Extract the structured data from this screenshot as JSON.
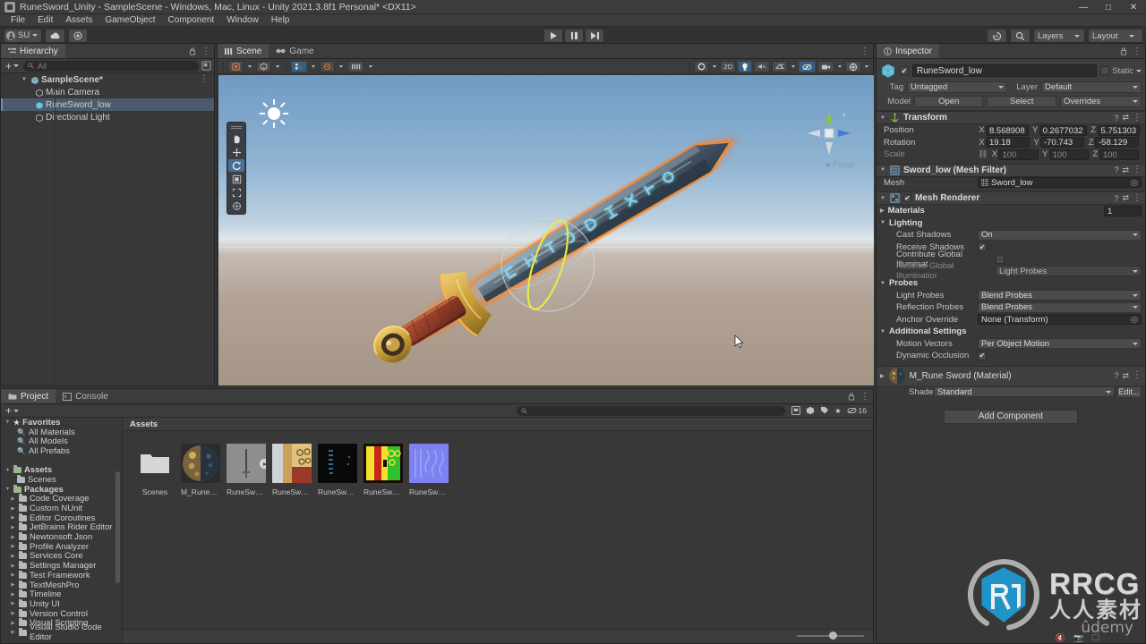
{
  "window": {
    "title": "RuneSword_Unity - SampleScene - Windows, Mac, Linux - Unity 2021.3.8f1 Personal* <DX11>",
    "app_icon": "unity-icon",
    "minimize": "—",
    "maximize": "□",
    "close": "✕"
  },
  "menu": {
    "items": [
      "File",
      "Edit",
      "Assets",
      "GameObject",
      "Component",
      "Window",
      "Help"
    ]
  },
  "toolbar": {
    "account_label": "SU",
    "cloud_icon": "cloud-icon",
    "services_icon": "unity-services-icon",
    "play_label": "play-icon",
    "pause_label": "pause-icon",
    "step_label": "step-icon",
    "history_icon": "undo-history-icon",
    "search_icon": "search-icon",
    "layers_label": "Layers",
    "layout_label": "Layout"
  },
  "hierarchy": {
    "tab_label": "Hierarchy",
    "tab_icon": "hierarchy-icon",
    "lock_icon": "lock-icon",
    "menu_icon": "kebab-icon",
    "add_label": "+",
    "search_placeholder": "All",
    "items": [
      {
        "label": "SampleScene*",
        "icon": "scene-icon",
        "depth": 0,
        "selected": false,
        "expanded": true
      },
      {
        "label": "Main Camera",
        "icon": "gameobject-icon",
        "depth": 1,
        "selected": false
      },
      {
        "label": "RuneSword_low",
        "icon": "prefab-model-icon",
        "depth": 1,
        "selected": true
      },
      {
        "label": "Directional Light",
        "icon": "gameobject-icon",
        "depth": 1,
        "selected": false
      }
    ]
  },
  "scene_panel": {
    "tabs": [
      {
        "label": "Scene",
        "icon": "scene-tab-icon",
        "active": true
      },
      {
        "label": "Game",
        "icon": "game-tab-icon",
        "active": false
      }
    ],
    "toolbar_left": [
      {
        "name": "draw-mode-shaded",
        "icon": "shaded-icon"
      },
      {
        "name": "shading-mode",
        "icon": "cube-wire-icon"
      },
      {
        "name": "2d-toggle-group",
        "icon": "grid-axis-icon",
        "active": true
      },
      {
        "name": "lighting-toggle",
        "icon": "audio-icon"
      },
      {
        "name": "grid-snap",
        "icon": "grid-snap-icon"
      }
    ],
    "toolbar_right": [
      {
        "name": "scene-view-lighting",
        "icon": "globe-icon"
      },
      {
        "name": "2d-button",
        "label": "2D"
      },
      {
        "name": "scene-lighting-toggle",
        "icon": "bulb-icon",
        "active": true
      },
      {
        "name": "audio-toggle",
        "icon": "speaker-mute-icon"
      },
      {
        "name": "fx-toggle",
        "icon": "fx-icon"
      },
      {
        "name": "hidden-toggle",
        "icon": "eye-off-icon",
        "active": true
      },
      {
        "name": "camera-settings",
        "icon": "camera-icon"
      },
      {
        "name": "gizmos-toggle",
        "icon": "gizmos-icon"
      }
    ],
    "tools_palette": [
      {
        "name": "hand-tool",
        "icon": "hand-icon",
        "active": false
      },
      {
        "name": "move-tool",
        "icon": "move-icon",
        "active": false
      },
      {
        "name": "rotate-tool",
        "icon": "rotate-icon",
        "active": true
      },
      {
        "name": "scale-tool",
        "icon": "scale-icon",
        "active": false
      },
      {
        "name": "rect-tool",
        "icon": "rect-icon",
        "active": false
      },
      {
        "name": "transform-tool",
        "icon": "transform-icon",
        "active": false
      }
    ],
    "gizmo_label": "Persp",
    "scene_object": "RuneSword_low sword 3D model",
    "sun_gizmo": "directional-light-gizmo"
  },
  "inspector": {
    "tab_label": "Inspector",
    "tab_icon": "inspector-icon",
    "lock_icon": "lock-icon",
    "menu_icon": "kebab-icon",
    "gameobject": {
      "enabled": true,
      "name": "RuneSword_low",
      "static_label": "Static",
      "tag_label": "Tag",
      "tag_value": "Untagged",
      "layer_label": "Layer",
      "layer_value": "Default",
      "model_label": "Model",
      "open_label": "Open",
      "select_label": "Select",
      "overrides_label": "Overrides"
    },
    "transform": {
      "title": "Transform",
      "icon": "transform-component-icon",
      "rows": [
        {
          "label": "Position",
          "x": "8.568908",
          "y": "0.2677032",
          "z": "5.751303",
          "dim": false
        },
        {
          "label": "Rotation",
          "x": "19.18",
          "y": "-70.743",
          "z": "-58.129",
          "dim": false
        },
        {
          "label": "Scale",
          "x": "100",
          "y": "100",
          "z": "100",
          "dim": true,
          "lock_icon": "link-icon"
        }
      ]
    },
    "mesh_filter": {
      "title": "Sword_low (Mesh Filter)",
      "icon": "mesh-filter-icon",
      "mesh_label": "Mesh",
      "mesh_value": "Sword_low"
    },
    "mesh_renderer": {
      "title": "Mesh Renderer",
      "icon": "mesh-renderer-icon",
      "enabled": true,
      "materials_label": "Materials",
      "materials_count": "1",
      "lighting_label": "Lighting",
      "cast_shadows_label": "Cast Shadows",
      "cast_shadows_value": "On",
      "receive_shadows_label": "Receive Shadows",
      "receive_shadows_checked": true,
      "contribute_gi_label": "Contribute Global Illuminat",
      "contribute_gi_checked": false,
      "receive_gi_label": "Receive Global Illuminatior",
      "receive_gi_value": "Light Probes",
      "probes_label": "Probes",
      "light_probes_label": "Light Probes",
      "light_probes_value": "Blend Probes",
      "reflection_probes_label": "Reflection Probes",
      "reflection_probes_value": "Blend Probes",
      "anchor_override_label": "Anchor Override",
      "anchor_override_value": "None (Transform)",
      "additional_settings_label": "Additional Settings",
      "motion_vectors_label": "Motion Vectors",
      "motion_vectors_value": "Per Object Motion",
      "dynamic_occlusion_label": "Dynamic Occlusion",
      "dynamic_occlusion_checked": true
    },
    "material": {
      "title": "M_Rune Sword (Material)",
      "shader_label": "Shader",
      "shader_value": "Standard",
      "edit_label": "Edit..."
    },
    "add_component_label": "Add Component"
  },
  "project": {
    "tabs": [
      {
        "label": "Project",
        "icon": "project-icon",
        "active": true
      },
      {
        "label": "Console",
        "icon": "console-icon",
        "active": false
      }
    ],
    "add_label": "+",
    "search_placeholder": "",
    "search_icon": "search-icon",
    "tool_icons": [
      "save-filter-icon",
      "packages-icon",
      "label-icon",
      "favorite-star-icon",
      "hidden-count-icon"
    ],
    "hidden_count": "16",
    "breadcrumb": "Assets",
    "tree": [
      {
        "label": "Favorites",
        "depth": 0,
        "bold": true,
        "fold": "▼",
        "icon": "star-icon"
      },
      {
        "label": "All Materials",
        "depth": 1,
        "icon": "search-icon"
      },
      {
        "label": "All Models",
        "depth": 1,
        "icon": "search-icon"
      },
      {
        "label": "All Prefabs",
        "depth": 1,
        "icon": "search-icon"
      },
      {
        "label": "",
        "depth": 0,
        "spacer": true
      },
      {
        "label": "Assets",
        "depth": 0,
        "bold": true,
        "fold": "▼",
        "icon": "folder-icon"
      },
      {
        "label": "Scenes",
        "depth": 1,
        "icon": "folder-icon"
      },
      {
        "label": "Packages",
        "depth": 0,
        "bold": true,
        "fold": "▼",
        "icon": "folder-icon"
      },
      {
        "label": "Code Coverage",
        "depth": 1,
        "fold": "▶",
        "icon": "folder-icon"
      },
      {
        "label": "Custom NUnit",
        "depth": 1,
        "fold": "▶",
        "icon": "folder-icon"
      },
      {
        "label": "Editor Coroutines",
        "depth": 1,
        "fold": "▶",
        "icon": "folder-icon"
      },
      {
        "label": "JetBrains Rider Editor",
        "depth": 1,
        "fold": "▶",
        "icon": "folder-icon"
      },
      {
        "label": "Newtonsoft Json",
        "depth": 1,
        "fold": "▶",
        "icon": "folder-icon"
      },
      {
        "label": "Profile Analyzer",
        "depth": 1,
        "fold": "▶",
        "icon": "folder-icon"
      },
      {
        "label": "Services Core",
        "depth": 1,
        "fold": "▶",
        "icon": "folder-icon"
      },
      {
        "label": "Settings Manager",
        "depth": 1,
        "fold": "▶",
        "icon": "folder-icon"
      },
      {
        "label": "Test Framework",
        "depth": 1,
        "fold": "▶",
        "icon": "folder-icon"
      },
      {
        "label": "TextMeshPro",
        "depth": 1,
        "fold": "▶",
        "icon": "folder-icon"
      },
      {
        "label": "Timeline",
        "depth": 1,
        "fold": "▶",
        "icon": "folder-icon"
      },
      {
        "label": "Unity UI",
        "depth": 1,
        "fold": "▶",
        "icon": "folder-icon"
      },
      {
        "label": "Version Control",
        "depth": 1,
        "fold": "▶",
        "icon": "folder-icon"
      },
      {
        "label": "Visual Scripting",
        "depth": 1,
        "fold": "▶",
        "icon": "folder-icon"
      },
      {
        "label": "Visual Studio Code Editor",
        "depth": 1,
        "fold": "▶",
        "icon": "folder-icon"
      }
    ],
    "assets": [
      {
        "label": "Scenes",
        "kind": "folder"
      },
      {
        "label": "M_RuneSw...",
        "kind": "material-sphere"
      },
      {
        "label": "RuneSwor...",
        "kind": "model",
        "has_play_badge": true
      },
      {
        "label": "RuneSwor...",
        "kind": "texture-albedo"
      },
      {
        "label": "RuneSwor...",
        "kind": "texture-emissive"
      },
      {
        "label": "RuneSwor...",
        "kind": "texture-mask"
      },
      {
        "label": "RuneSwor...",
        "kind": "texture-normal"
      }
    ],
    "zoom_value": "48"
  },
  "watermark": {
    "brand": "RRCG",
    "brand_cn": "人人素材",
    "secondary": "ûdemy",
    "logo_icon": "rrcg-logo-icon"
  },
  "colors": {
    "panel_bg": "#383838",
    "panel_header": "#3c3c3c",
    "accent_selection": "#4b5b6b",
    "tool_active": "#4a6f96",
    "sky_top": "#6f9bc4",
    "ground": "#a59585",
    "sword_accent": "#e8803a",
    "rune_glow": "#7fd4e8",
    "brand_blue": "#1f9bd4"
  }
}
